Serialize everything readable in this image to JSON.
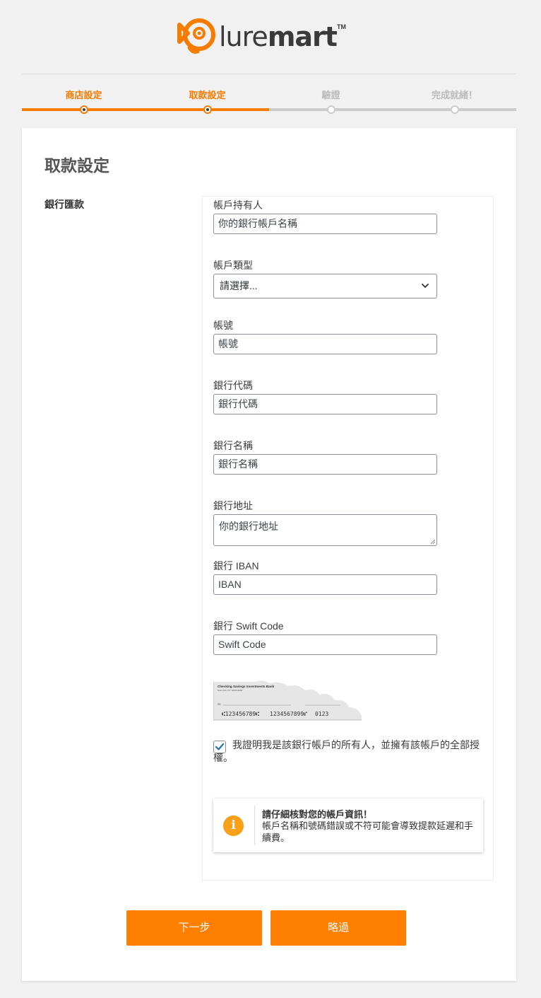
{
  "brand": {
    "logo_light": "lure",
    "logo_bold": "mart",
    "trademark": "TM",
    "accent_color": "#ff7f00"
  },
  "steps": [
    {
      "label": "商店設定",
      "state": "done"
    },
    {
      "label": "取款設定",
      "state": "current"
    },
    {
      "label": "驗證",
      "state": "todo"
    },
    {
      "label": "完成就緒！",
      "state": "todo"
    }
  ],
  "card": {
    "title": "取款設定",
    "section_label": "銀行匯款"
  },
  "form": {
    "account_holder": {
      "label": "帳戶持有人",
      "value": "你的銀行帳戶名稱"
    },
    "account_type": {
      "label": "帳戶類型",
      "selected": "請選擇..."
    },
    "account_number": {
      "label": "帳號",
      "value": "帳號"
    },
    "bank_code": {
      "label": "銀行代碼",
      "value": "銀行代碼"
    },
    "bank_name": {
      "label": "銀行名稱",
      "value": "銀行名稱"
    },
    "bank_address": {
      "label": "銀行地址",
      "value": "你的銀行地址"
    },
    "iban": {
      "label": "銀行 IBAN",
      "value": "IBAN"
    },
    "swift": {
      "label": "銀行 Swift Code",
      "value": "Swift Code"
    }
  },
  "check_image": {
    "bank_name": "Checking Savings Investments Bank",
    "bank_city": "New York, NY 12345-6666",
    "memo_label": "RE",
    "routing": "⑆123456789⑆",
    "account": "1234567899⑈",
    "check_no": "0123"
  },
  "confirm": {
    "checked": true,
    "line1": "我證明我是該銀行帳戶的所有人，並擁有該帳戶的全部授",
    "line2": "權。"
  },
  "notice": {
    "icon": "info-icon",
    "title": "請仔細核對您的帳戶資訊！",
    "body": "帳戶名稱和號碼錯誤或不符可能會導致提款延遲和手續費。"
  },
  "buttons": {
    "next": "下一步",
    "skip": "略過"
  }
}
